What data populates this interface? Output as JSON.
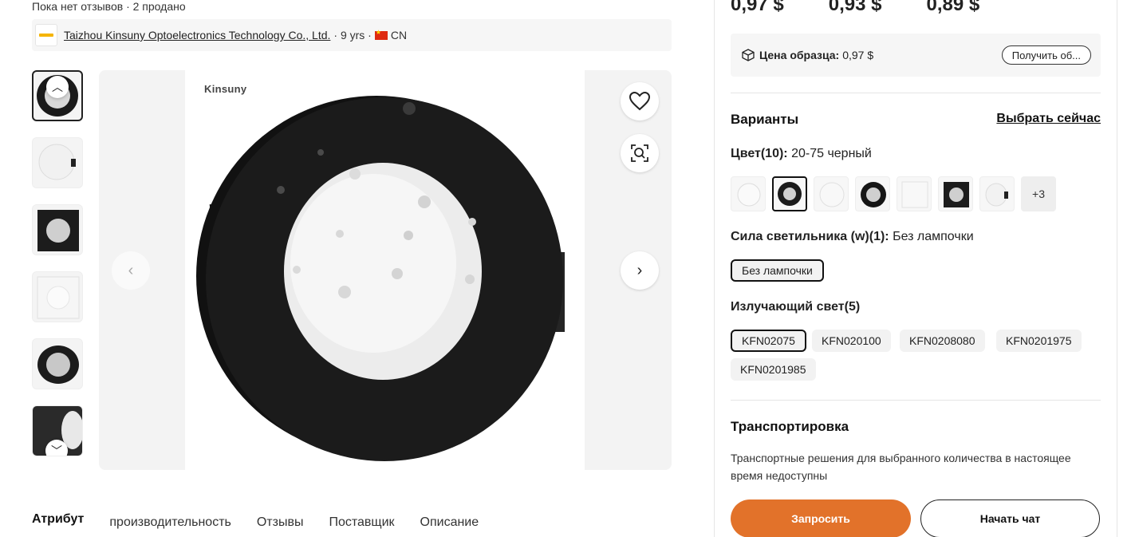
{
  "review_summary": "Пока нет отзывов · 2 продано",
  "supplier": {
    "name": "Taizhou Kinsuny Optoelectronics Technology Co., Ltd.",
    "years": "· 9 yrs ·",
    "country": "CN"
  },
  "gallery": {
    "brand": "Kinsuny",
    "thumbnail_count": 6
  },
  "tabs": [
    "Атрибут",
    "производительность",
    "Отзывы",
    "Поставщик",
    "Описание"
  ],
  "prices": [
    "0,97 $",
    "0,93 $",
    "0,89 $"
  ],
  "sample": {
    "label": "Цена образца:",
    "price": "0,97 $",
    "button": "Получить об..."
  },
  "variants": {
    "title": "Варианты",
    "select_now": "Выбрать сейчас",
    "color_label": "Цвет(10):",
    "color_value": "20-75 черный",
    "color_more": "+3",
    "power_label": "Сила светильника (w)(1):",
    "power_value": "Без лампочки",
    "power_options": [
      "Без лампочки"
    ],
    "light_label": "Излучающий свет(5)",
    "light_options": [
      "KFN02075",
      "KFN020100",
      "KFN0208080",
      "KFN0201975",
      "KFN0201985"
    ]
  },
  "shipping": {
    "title": "Транспортировка",
    "text": "Транспортные решения для выбранного количества в настоящее время недоступны"
  },
  "actions": {
    "inquire": "Запросить",
    "chat": "Начать чат"
  }
}
